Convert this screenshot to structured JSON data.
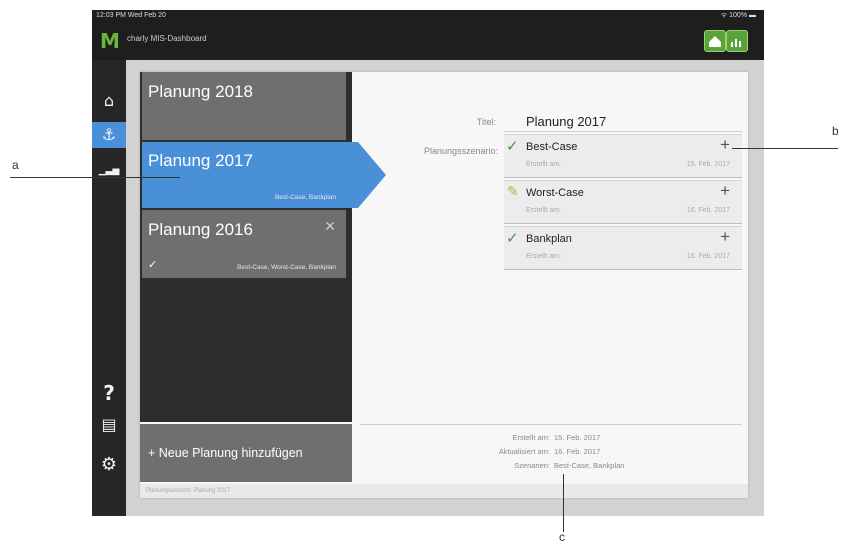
{
  "status": {
    "time_date": "12:03 PM  Wed Feb 20",
    "battery": "100%"
  },
  "app": {
    "title": "charly MIS-Dashboard",
    "logo": "M"
  },
  "nav": [
    {
      "name": "home-icon",
      "glyph": "⌂"
    },
    {
      "name": "planning-icon",
      "glyph": "⚓"
    },
    {
      "name": "chart-icon",
      "glyph": "▁▃▅"
    },
    {
      "name": "help-icon",
      "glyph": "?"
    },
    {
      "name": "message-icon",
      "glyph": "▤"
    },
    {
      "name": "settings-icon",
      "glyph": "⚙"
    }
  ],
  "plans": [
    {
      "title": "Planung 2018",
      "scenarios": ""
    },
    {
      "title": "Planung 2017",
      "scenarios": "Best-Case, Bankplan"
    },
    {
      "title": "Planung 2016",
      "scenarios": "Best-Case, Worst-Case, Bankplan",
      "close": "✕",
      "check": "✓"
    }
  ],
  "add_plan": "+ Neue Planung hinzufügen",
  "footer": "Planungsansicht: Planung 2017",
  "detail": {
    "title_label": "Titel:",
    "title_value": "Planung 2017",
    "scenario_label": "Planungsszenario:",
    "scenarios": [
      {
        "name": "Best-Case",
        "created_label": "Erstellt am:",
        "date": "15. Feb. 2017",
        "status": "check"
      },
      {
        "name": "Worst-Case",
        "created_label": "Erstellt am:",
        "date": "16. Feb. 2017",
        "status": "edit"
      },
      {
        "name": "Bankplan",
        "created_label": "Erstellt am:",
        "date": "16. Feb. 2017",
        "status": "check"
      }
    ],
    "meta": {
      "created_label": "Erstellt am:",
      "created": "15. Feb. 2017",
      "updated_label": "Aktualisiert am:",
      "updated": "16. Feb. 2017",
      "scenarios_label": "Szenarien:",
      "scenarios": "Best-Case, Bankplan"
    }
  },
  "callouts": {
    "a": "a",
    "b": "b",
    "c": "c"
  },
  "colors": {
    "accent": "#4a90d9",
    "check": "#3d9b35",
    "sidebar": "#262626",
    "item": "#6f6f6f"
  }
}
